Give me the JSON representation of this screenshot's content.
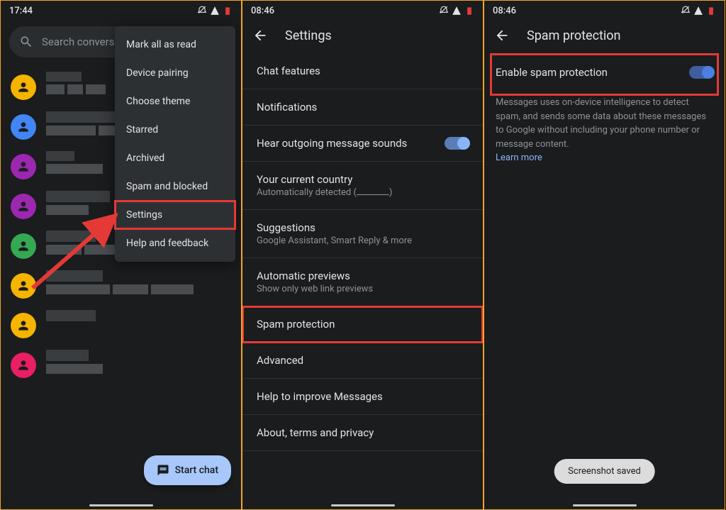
{
  "screen1": {
    "time": "17:44",
    "search_placeholder": "Search conversat",
    "menu": {
      "items": [
        "Mark all as read",
        "Device pairing",
        "Choose theme",
        "Starred",
        "Archived",
        "Spam and blocked",
        "Settings",
        "Help and feedback"
      ],
      "highlighted_index": 6
    },
    "avatar_colors": [
      "#f4b400",
      "#4285f4",
      "#9c27b0",
      "#9c27b0",
      "#34a853",
      "#f4b400",
      "#f4b400",
      "#e91e63"
    ],
    "fab_label": "Start chat"
  },
  "screen2": {
    "time": "08:46",
    "title": "Settings",
    "rows": [
      {
        "title": "Chat features"
      },
      {
        "title": "Notifications"
      },
      {
        "title": "Hear outgoing message sounds",
        "toggle": true
      },
      {
        "title": "Your current country",
        "sub_prefix": "Automatically detected (",
        "sub_suffix": ")"
      },
      {
        "title": "Suggestions",
        "sub": "Google Assistant, Smart Reply & more"
      },
      {
        "title": "Automatic previews",
        "sub": "Show only web link previews"
      },
      {
        "title": "Spam protection",
        "highlight": true
      },
      {
        "title": "Advanced"
      },
      {
        "title": "Help to improve Messages"
      },
      {
        "title": "About, terms and privacy"
      }
    ]
  },
  "screen3": {
    "time": "08:46",
    "title": "Spam protection",
    "enable_label": "Enable spam protection",
    "info_text": "Messages uses on-device intelligence to detect spam, and sends some data about these messages to Google without including your phone number or message content.",
    "learn_more": "Learn more",
    "toast": "Screenshot saved"
  }
}
